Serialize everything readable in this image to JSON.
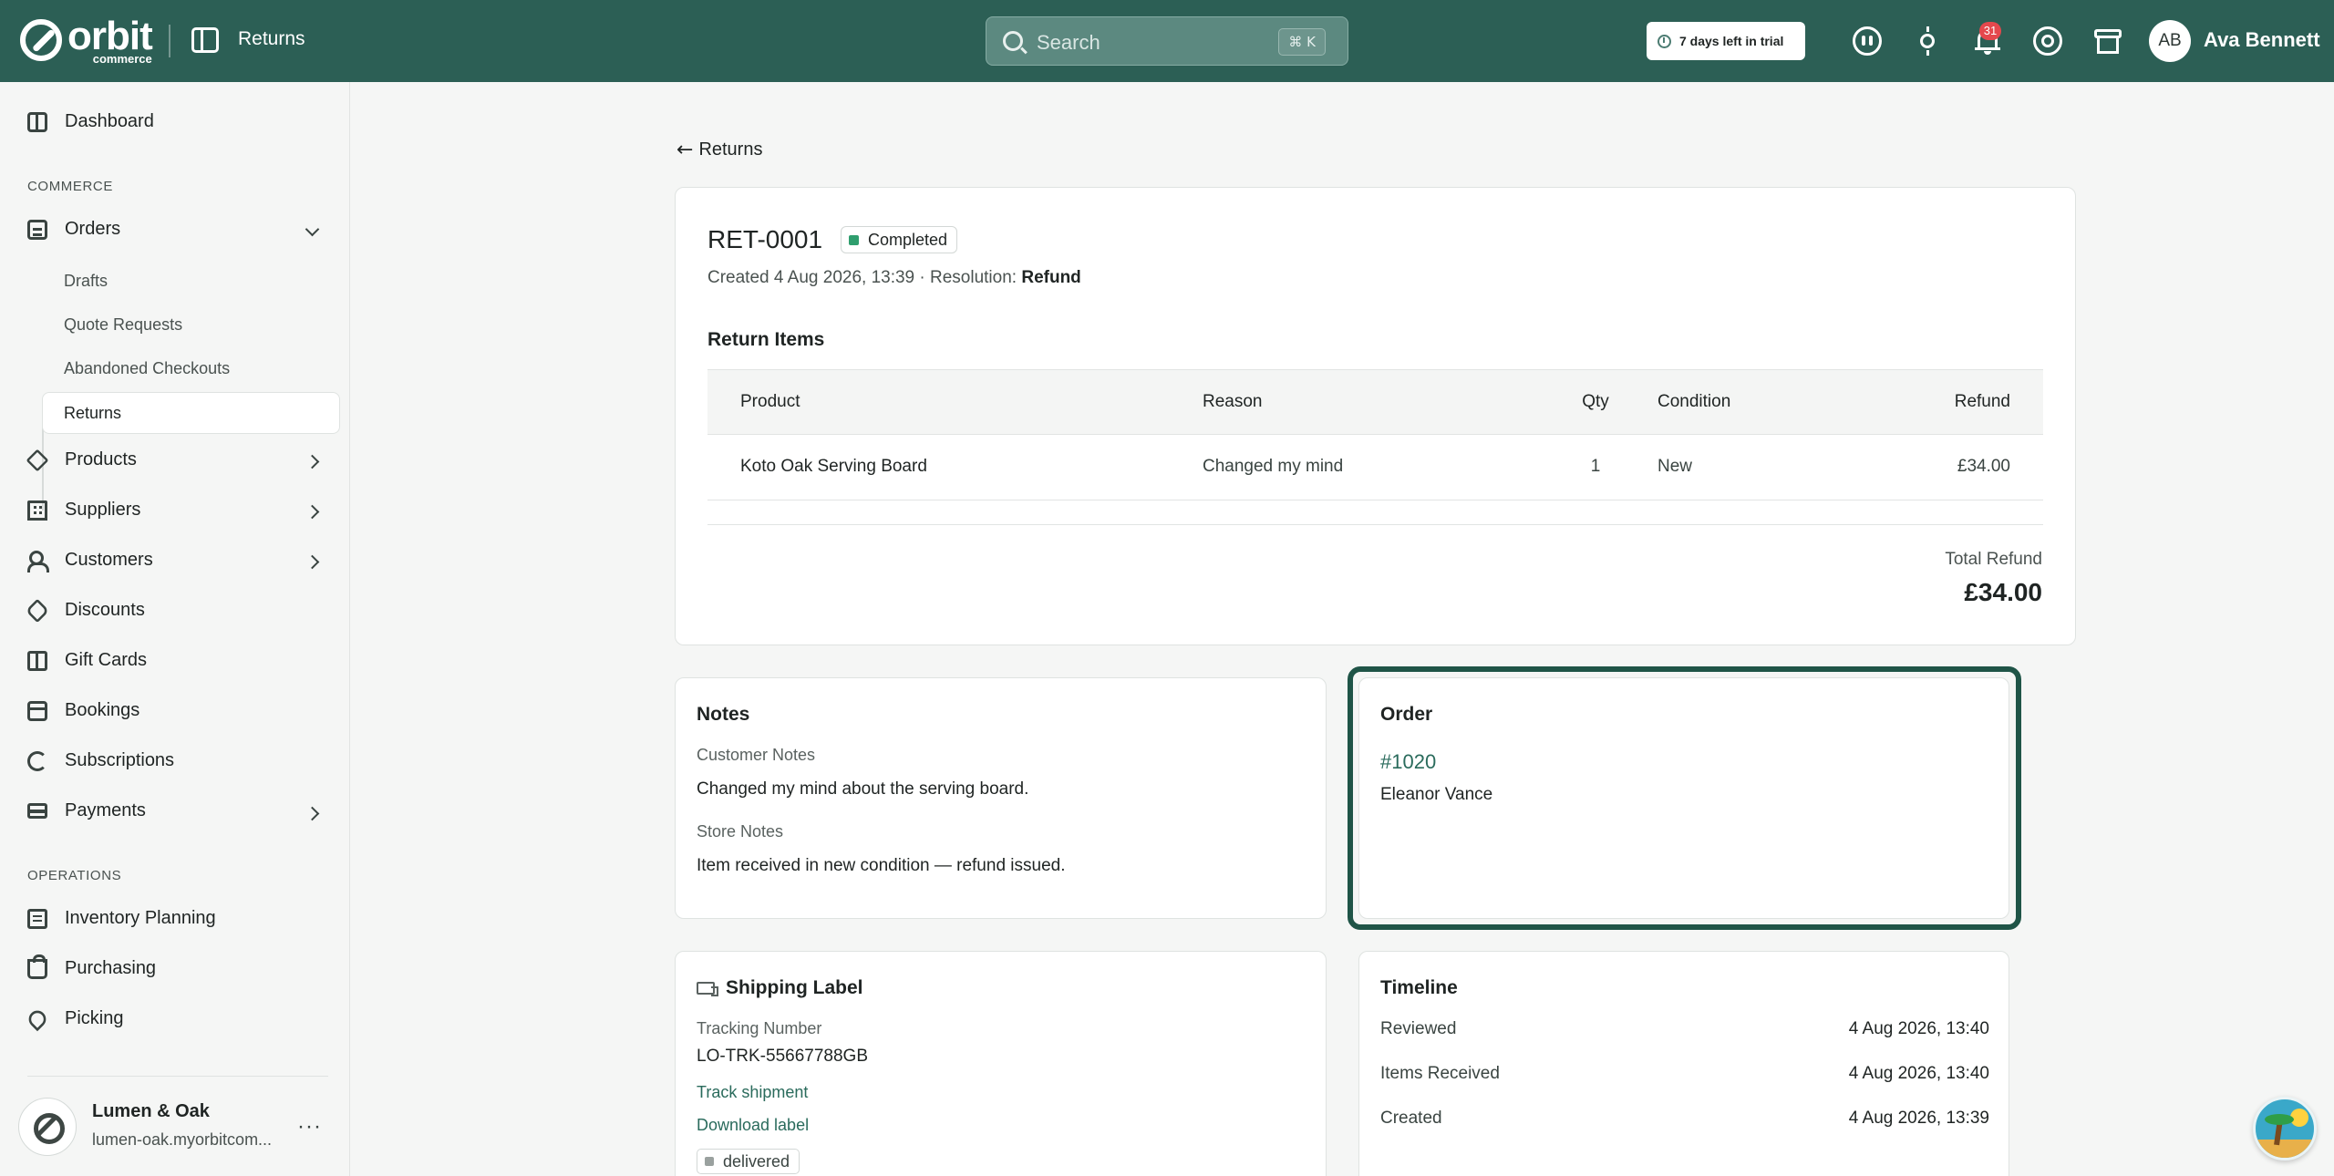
{
  "topbar": {
    "logo_word": "orbit",
    "logo_sub": "commerce",
    "page_title": "Returns",
    "search_placeholder": "Search",
    "search_shortcut": "⌘ K",
    "trial_text": "7 days left in trial",
    "notification_count": "31",
    "user_initials": "AB",
    "user_name": "Ava Bennett",
    "icons": [
      "sidebar-toggle-icon",
      "search-icon",
      "clock-icon",
      "ai-assistant-icon",
      "sun-icon",
      "bell-icon",
      "help-icon",
      "store-icon"
    ]
  },
  "sidebar": {
    "dashboard": "Dashboard",
    "section_commerce": "COMMERCE",
    "orders": "Orders",
    "orders_sub": [
      "Drafts",
      "Quote Requests",
      "Abandoned Checkouts",
      "Returns"
    ],
    "products": "Products",
    "suppliers": "Suppliers",
    "customers": "Customers",
    "discounts": "Discounts",
    "gift_cards": "Gift Cards",
    "bookings": "Bookings",
    "subscriptions": "Subscriptions",
    "payments": "Payments",
    "section_operations": "OPERATIONS",
    "inventory_planning": "Inventory Planning",
    "purchasing": "Purchasing",
    "picking": "Picking",
    "store_name": "Lumen & Oak",
    "store_url": "lumen-oak.myorbitcom...",
    "store_more": "···"
  },
  "main": {
    "back_label": "Returns",
    "return_id": "RET-0001",
    "status": "Completed",
    "created_label": "Created 4 Aug 2026, 13:39 · Resolution:",
    "resolution": "Refund",
    "items_title": "Return Items",
    "columns": {
      "product": "Product",
      "reason": "Reason",
      "qty": "Qty",
      "condition": "Condition",
      "refund": "Refund"
    },
    "rows": [
      {
        "product": "Koto Oak Serving Board",
        "reason": "Changed my mind",
        "qty": "1",
        "condition": "New",
        "refund": "£34.00"
      }
    ],
    "total_label": "Total Refund",
    "total_value": "£34.00"
  },
  "notes": {
    "title": "Notes",
    "customer_label": "Customer Notes",
    "customer_text": "Changed my mind about the serving board.",
    "store_label": "Store Notes",
    "store_text": "Item received in new condition — refund issued."
  },
  "order": {
    "title": "Order",
    "number": "#1020",
    "customer": "Eleanor Vance"
  },
  "shipping": {
    "title": "Shipping Label",
    "tracking_label": "Tracking Number",
    "tracking_number": "LO-TRK-55667788GB",
    "track_link": "Track shipment",
    "download_link": "Download label",
    "status": "delivered"
  },
  "timeline": {
    "title": "Timeline",
    "events": [
      {
        "label": "Reviewed",
        "time": "4 Aug 2026, 13:40"
      },
      {
        "label": "Items Received",
        "time": "4 Aug 2026, 13:40"
      },
      {
        "label": "Created",
        "time": "4 Aug 2026, 13:39"
      }
    ]
  },
  "colors": {
    "topbar": "#2c5f55",
    "accent_link": "#2a6b5c",
    "status_completed": "#2f9e6e",
    "highlight_border": "#1f5447"
  }
}
